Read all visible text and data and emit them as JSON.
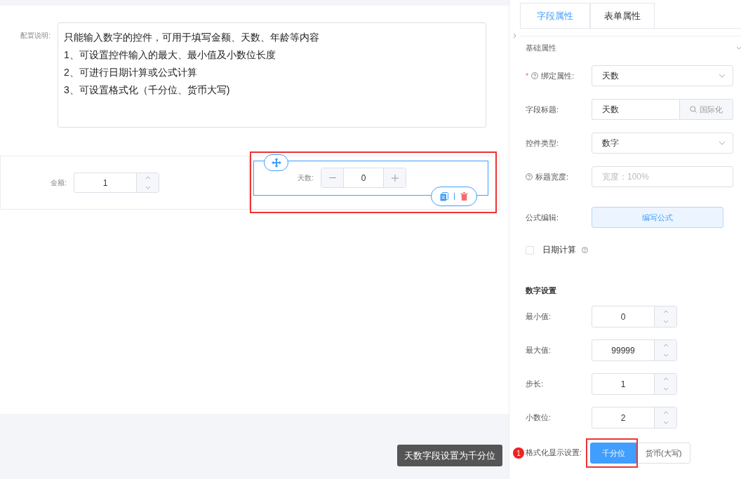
{
  "canvas": {
    "description": {
      "label": "配置说明:",
      "lines": [
        "只能输入数字的控件，可用于填写金额、天数、年龄等内容",
        "1、可设置控件输入的最大、最小值及小数位长度",
        "2、可进行日期计算或公式计算",
        "3、可设置格式化（千分位、货币大写)"
      ]
    },
    "fields": [
      {
        "kind": "spinner",
        "label": "金额:",
        "value": "1",
        "selected": false
      },
      {
        "kind": "stepper",
        "label": "天数:",
        "value": "0",
        "selected": true
      }
    ]
  },
  "panel": {
    "tabs": [
      {
        "label": "字段属性",
        "selected": true
      },
      {
        "label": "表单属性",
        "selected": false
      }
    ],
    "section": "基础属性",
    "rows": [
      {
        "kind": "select",
        "label": "绑定属性:",
        "asterisk": "*",
        "help": true,
        "value": "天数"
      },
      {
        "kind": "addon",
        "label": "字段标题:",
        "help": false,
        "value": "天数",
        "addon": "国际化"
      },
      {
        "kind": "select",
        "label": "控件类型:",
        "help": false,
        "value": "数字"
      },
      {
        "kind": "input",
        "label": "标题宽度:",
        "help": true,
        "placeholder": "宽度：100%"
      },
      {
        "kind": "button",
        "label": "公式编辑:",
        "help": false,
        "button": "编写公式"
      }
    ],
    "checkbox": {
      "label": "日期计算",
      "checked": false
    },
    "number_section": "数字设置",
    "number_rows": [
      {
        "label": "最小值:",
        "value": "0"
      },
      {
        "label": "最大值:",
        "value": "99999"
      },
      {
        "label": "步长:",
        "value": "1"
      },
      {
        "label": "小数位:",
        "value": "2"
      }
    ],
    "format": {
      "label": "格式化显示设置:",
      "options": [
        {
          "label": "千分位",
          "selected": true
        },
        {
          "label": "货币(大写)",
          "selected": false
        }
      ]
    }
  },
  "callout": {
    "badge": "1",
    "text": "天数字段设置为千分位"
  }
}
